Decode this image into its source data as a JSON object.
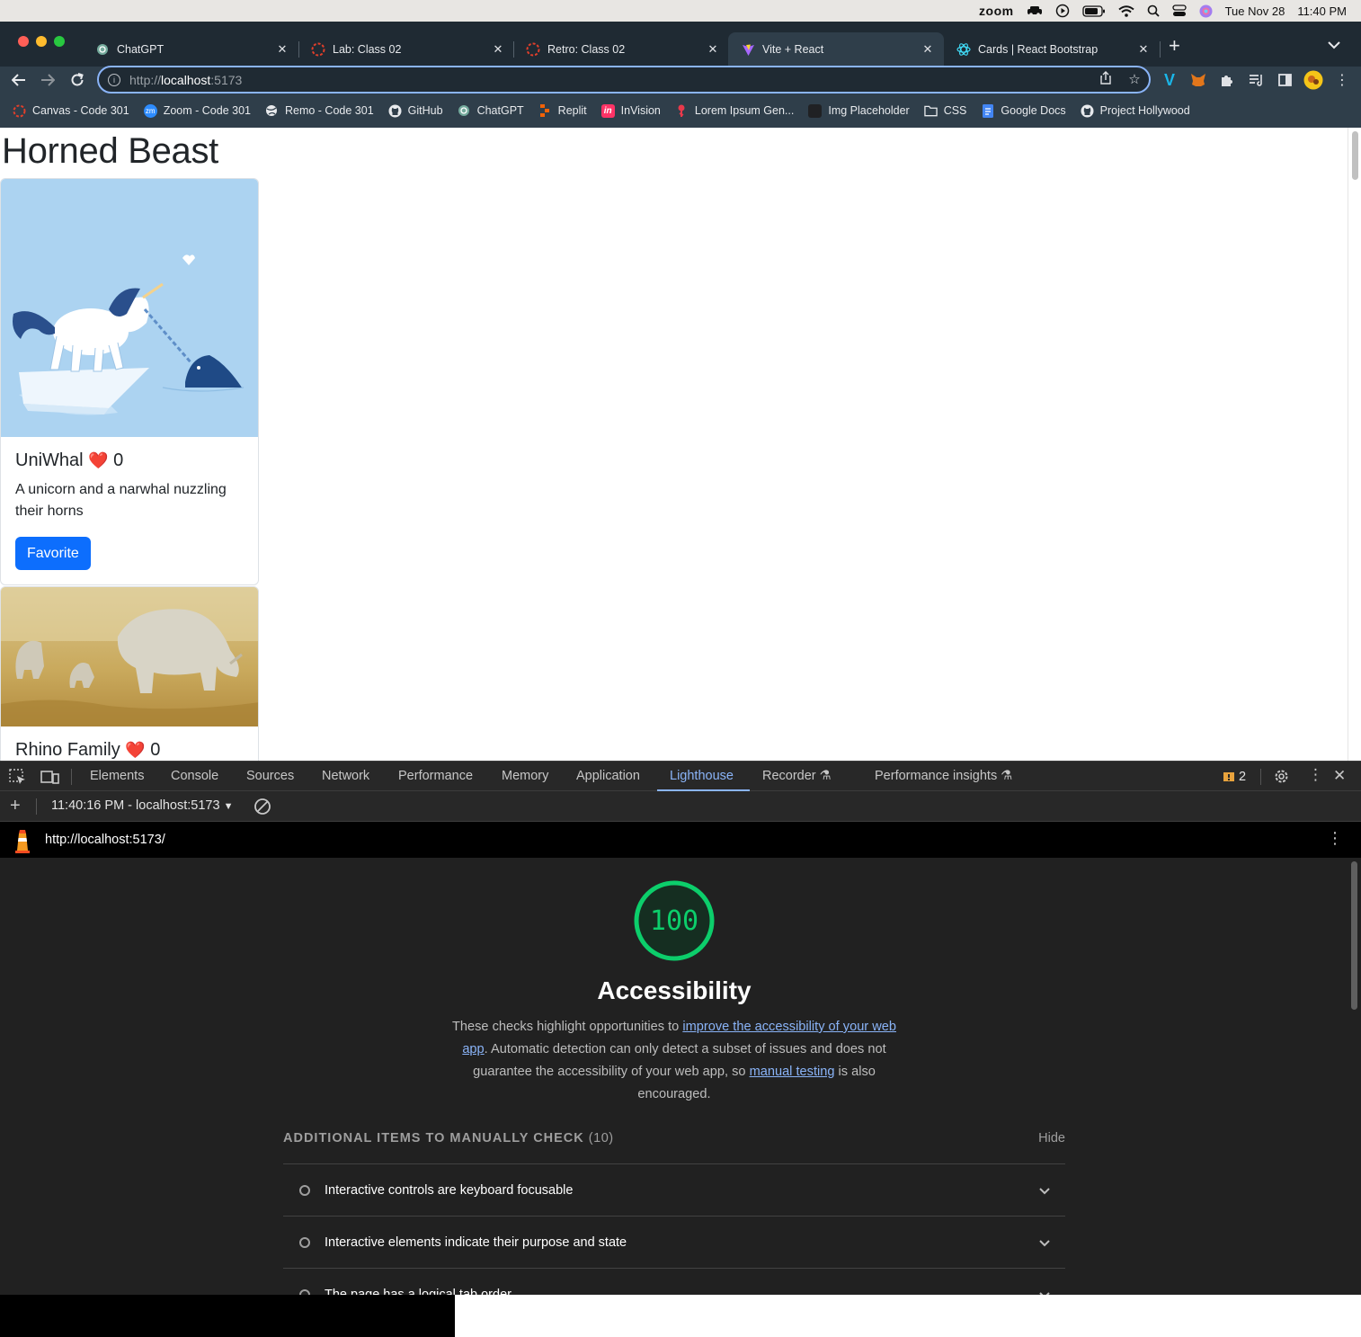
{
  "menubar": {
    "zoom_label": "zoom",
    "date": "Tue Nov 28",
    "time": "11:40 PM"
  },
  "tabs": [
    {
      "title": "ChatGPT",
      "icon": "chatgpt-icon"
    },
    {
      "title": "Lab: Class 02",
      "icon": "canvas-icon"
    },
    {
      "title": "Retro: Class 02",
      "icon": "canvas-icon"
    },
    {
      "title": "Vite + React",
      "icon": "vite-icon",
      "active": true
    },
    {
      "title": "Cards | React Bootstrap",
      "icon": "react-bootstrap-icon"
    }
  ],
  "new_tab_symbol": "+",
  "address": {
    "scheme": "http://",
    "host": "localhost",
    "port": ":5173"
  },
  "bookmarks": [
    {
      "label": "Canvas - Code 301",
      "icon": "canvas-icon"
    },
    {
      "label": "Zoom - Code 301",
      "icon": "zoom-icon"
    },
    {
      "label": "Remo - Code 301",
      "icon": "globe-icon"
    },
    {
      "label": "GitHub",
      "icon": "github-icon"
    },
    {
      "label": "ChatGPT",
      "icon": "chatgpt-icon"
    },
    {
      "label": "Replit",
      "icon": "replit-icon"
    },
    {
      "label": "InVision",
      "icon": "invision-icon"
    },
    {
      "label": "Lorem Ipsum Gen...",
      "icon": "lorem-icon"
    },
    {
      "label": "Img Placeholder",
      "icon": "placeholder-icon"
    },
    {
      "label": "CSS",
      "icon": "folder-icon"
    },
    {
      "label": "Google Docs",
      "icon": "docs-icon"
    },
    {
      "label": "Project Hollywood",
      "icon": "github-icon"
    }
  ],
  "page": {
    "title": "Horned Beast",
    "cards": [
      {
        "name": "UniWhal",
        "heart": "❤️",
        "count": "0",
        "description": "A unicorn and a narwhal nuzzling their horns",
        "button": "Favorite"
      },
      {
        "name": "Rhino Family",
        "heart": "❤️",
        "count": "0"
      }
    ]
  },
  "devtools": {
    "tabs": [
      "Elements",
      "Console",
      "Sources",
      "Network",
      "Performance",
      "Memory",
      "Application",
      "Lighthouse",
      "Recorder",
      "Performance insights"
    ],
    "active_tab": "Lighthouse",
    "issues_count": "2",
    "report_selector": "11:40:16 PM - localhost:5173",
    "report_url": "http://localhost:5173/"
  },
  "lighthouse": {
    "score": "100",
    "score_fraction": 1.0,
    "category": "Accessibility",
    "desc_1": "These checks highlight opportunities to ",
    "link_1": "improve the accessibility of your web app",
    "desc_2": ". Automatic detection can only detect a subset of issues and does not guarantee the accessibility of your web app, so ",
    "link_2": "manual testing",
    "desc_3": " is also encouraged.",
    "manual_header": "ADDITIONAL ITEMS TO MANUALLY CHECK",
    "manual_count": "(10)",
    "hide_label": "Hide",
    "audits": [
      "Interactive controls are keyboard focusable",
      "Interactive elements indicate their purpose and state",
      "The page has a logical tab order"
    ],
    "colors": {
      "pass": "#0cce6b",
      "link": "#8ab4f8"
    }
  }
}
